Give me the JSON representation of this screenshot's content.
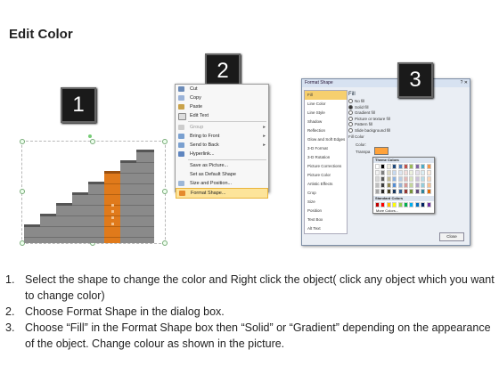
{
  "page": {
    "title": "Edit Color"
  },
  "badges": [
    "1",
    "2",
    "3"
  ],
  "context_menu": {
    "items": [
      {
        "label": "Cut",
        "icon": "scissors-icon",
        "enabled": true
      },
      {
        "label": "Copy",
        "icon": "copy-icon",
        "enabled": true
      },
      {
        "label": "Paste",
        "icon": "paste-icon",
        "enabled": true
      },
      {
        "label": "Edit Text",
        "icon": "edit-text-icon",
        "enabled": true
      },
      {
        "label": "Group",
        "icon": "group-icon",
        "enabled": false,
        "submenu": true
      },
      {
        "label": "Bring to Front",
        "icon": "bring-front-icon",
        "enabled": true,
        "submenu": true
      },
      {
        "label": "Send to Back",
        "icon": "send-back-icon",
        "enabled": true,
        "submenu": true
      },
      {
        "label": "Hyperlink...",
        "icon": "hyperlink-icon",
        "enabled": true
      },
      {
        "label": "Save as Picture...",
        "icon": "",
        "enabled": true
      },
      {
        "label": "Set as Default Shape",
        "icon": "",
        "enabled": true
      },
      {
        "label": "Size and Position...",
        "icon": "size-icon",
        "enabled": true
      },
      {
        "label": "Format Shape...",
        "icon": "format-shape-icon",
        "enabled": true,
        "highlighted": true
      }
    ]
  },
  "dialog": {
    "title": "Format Shape",
    "sidebar": [
      "Fill",
      "Line Color",
      "Line Style",
      "Shadow",
      "Reflection",
      "Glow and Soft Edges",
      "3-D Format",
      "3-D Rotation",
      "Picture Corrections",
      "Picture Color",
      "Artistic Effects",
      "Crop",
      "Size",
      "Position",
      "Text Box",
      "Alt Text"
    ],
    "selected": "Fill",
    "fill_heading": "Fill",
    "options": [
      {
        "label": "No fill",
        "on": false
      },
      {
        "label": "Solid fill",
        "on": true
      },
      {
        "label": "Gradient fill",
        "on": false
      },
      {
        "label": "Picture or texture fill",
        "on": false
      },
      {
        "label": "Pattern fill",
        "on": false
      },
      {
        "label": "Slide background fill",
        "on": false
      }
    ],
    "fill_color_label": "Fill Color",
    "color_label": "Color:",
    "transparency_label": "Transpa",
    "close_label": "Close",
    "palette": {
      "theme_label": "Theme Colors",
      "standard_label": "Standard Colors",
      "more_label": "More Colors..."
    }
  },
  "instructions": [
    {
      "num": "1.",
      "text": "Select the shape to change the color and Right click the object( click any object which you want to change color)"
    },
    {
      "num": "2.",
      "text": "Choose Format Shape in the dialog box."
    },
    {
      "num": "3.",
      "text": "Choose “Fill” in the Format Shape box then “Solid” or “Gradient” depending on the appearance of the object. Change colour as shown in the picture."
    }
  ],
  "colors": {
    "accent_orange": "#e07a1b",
    "highlight": "#fde49a",
    "gray_block": "#8a8a8a"
  }
}
